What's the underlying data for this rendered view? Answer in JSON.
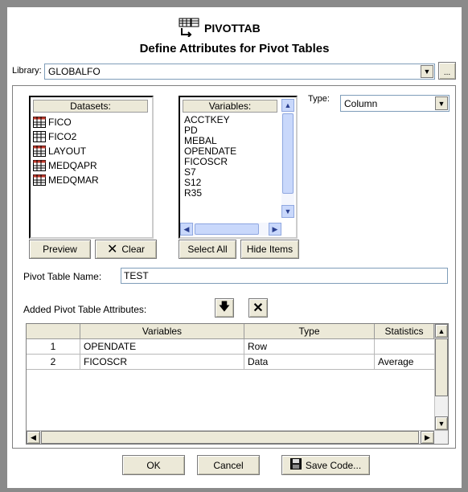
{
  "header": {
    "app_title": "PIVOTTAB",
    "subtitle": "Define Attributes for Pivot Tables"
  },
  "library": {
    "label": "Library:",
    "value": "GLOBALFO",
    "browse_label": "..."
  },
  "datasets": {
    "header": "Datasets:",
    "items": [
      "FICO",
      "FICO2",
      "LAYOUT",
      "MEDQAPR",
      "MEDQMAR"
    ]
  },
  "variables": {
    "header": "Variables:",
    "items": [
      "ACCTKEY",
      "PD",
      "MEBAL",
      "OPENDATE",
      "FICOSCR",
      "S7",
      "S12",
      "R35"
    ]
  },
  "type": {
    "label": "Type:",
    "value": "Column"
  },
  "buttons": {
    "preview": "Preview",
    "clear": "Clear",
    "select_all": "Select All",
    "hide_items": "Hide Items",
    "ok": "OK",
    "cancel": "Cancel",
    "save_code": "Save Code..."
  },
  "pivot_name": {
    "label": "Pivot Table Name:",
    "value": "TEST"
  },
  "attributes": {
    "label": "Added Pivot Table Attributes:",
    "columns": [
      "Variables",
      "Type",
      "Statistics"
    ],
    "rows": [
      {
        "num": "1",
        "variable": "OPENDATE",
        "type": "Row",
        "stat": ""
      },
      {
        "num": "2",
        "variable": "FICOSCR",
        "type": "Data",
        "stat": "Average"
      }
    ]
  }
}
